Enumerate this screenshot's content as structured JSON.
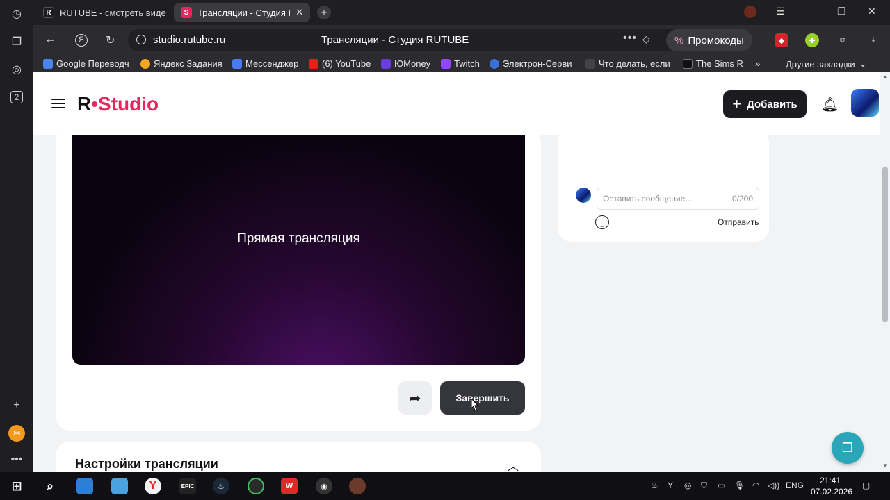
{
  "browser": {
    "tabs": [
      {
        "label": "RUTUBE - смотреть виде",
        "favicon": "R"
      },
      {
        "label": "Трансляции - Студия R",
        "favicon": "S"
      }
    ],
    "url": "studio.rutube.ru",
    "page_title": "Трансляции - Студия RUTUBE",
    "promo_label": "Промокоды",
    "rail_badge": "2",
    "bookmarks": [
      "Google Переводч",
      "Яндекс Задания",
      "Мессенджер",
      "(6) YouTube",
      "ЮMoney",
      "Twitch",
      "Электрон-Серви",
      "Что делать, если",
      "The Sims R"
    ],
    "other_bookmarks": "Другие закладки"
  },
  "studio": {
    "logo_r": "R",
    "logo_text": "Studio",
    "add_label": "Добавить",
    "player_label": "Прямая трансляция",
    "end_label": "Завершить",
    "chat": {
      "placeholder": "Оставить сообщение...",
      "counter": "0/200",
      "send_label": "Отправить"
    },
    "settings_title": "Настройки трансляции"
  },
  "taskbar": {
    "lang": "ENG",
    "time": "21:41",
    "date": "07.02.2026"
  },
  "colors": {
    "accent": "#e8265e",
    "dark_button": "#1c1c20",
    "help_button": "#2aa6b8"
  }
}
